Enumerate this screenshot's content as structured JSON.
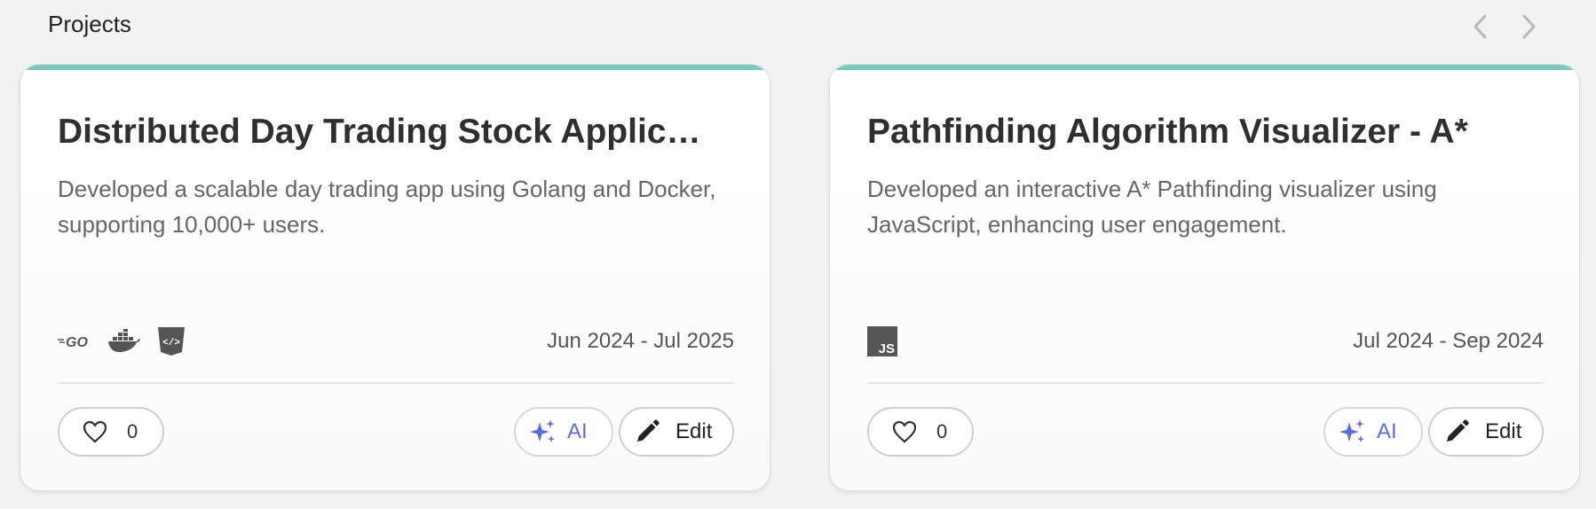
{
  "section": {
    "title": "Projects"
  },
  "navigation": {
    "prev_icon": "chevron-left-icon",
    "next_icon": "chevron-right-icon"
  },
  "cards": [
    {
      "title": "Distributed Day Trading Stock Applic…",
      "description": "Developed a scalable day trading app using Golang and Docker, supporting 10,000+ users.",
      "tech_icons": [
        "go-icon",
        "docker-icon",
        "html-icon"
      ],
      "date_range": "Jun 2024 - Jul 2025",
      "like_count": "0",
      "ai_label": "AI",
      "edit_label": "Edit"
    },
    {
      "title": "Pathfinding Algorithm Visualizer - A*",
      "description": "Developed an interactive A* Pathfinding visualizer using JavaScript, enhancing user engagement.",
      "tech_icons": [
        "javascript-icon"
      ],
      "date_range": "Jul 2024 - Sep 2024",
      "like_count": "0",
      "ai_label": "AI",
      "edit_label": "Edit"
    }
  ],
  "colors": {
    "accent_top_border": "#7cc8c0",
    "ai_accent": "#5a6de0",
    "background": "#f2f2f2"
  }
}
